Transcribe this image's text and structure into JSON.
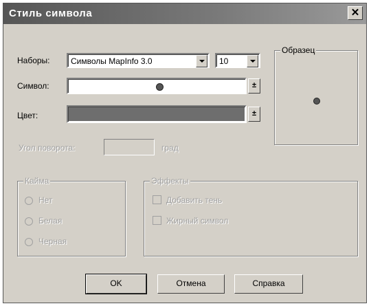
{
  "window": {
    "title": "Стиль символа",
    "close_glyph": "✕"
  },
  "sets": {
    "label": "Наборы:",
    "value": "Символы MapInfo 3.0",
    "size": "10"
  },
  "symbol": {
    "label": "Символ:",
    "picker_glyph": "±"
  },
  "color": {
    "label": "Цвет:",
    "value": "#6e6e6e",
    "picker_glyph": "±"
  },
  "rotation": {
    "label": "Угол поворота:",
    "unit": "град"
  },
  "sample": {
    "legend": "Образец"
  },
  "halo": {
    "legend": "Кайма",
    "options": [
      "Нет",
      "Белая",
      "Черная"
    ]
  },
  "effects": {
    "legend": "Эффекты",
    "options": [
      "Добавить тень",
      "Жирный символ"
    ]
  },
  "buttons": {
    "ok": "OK",
    "cancel": "Отмена",
    "help": "Справка"
  }
}
